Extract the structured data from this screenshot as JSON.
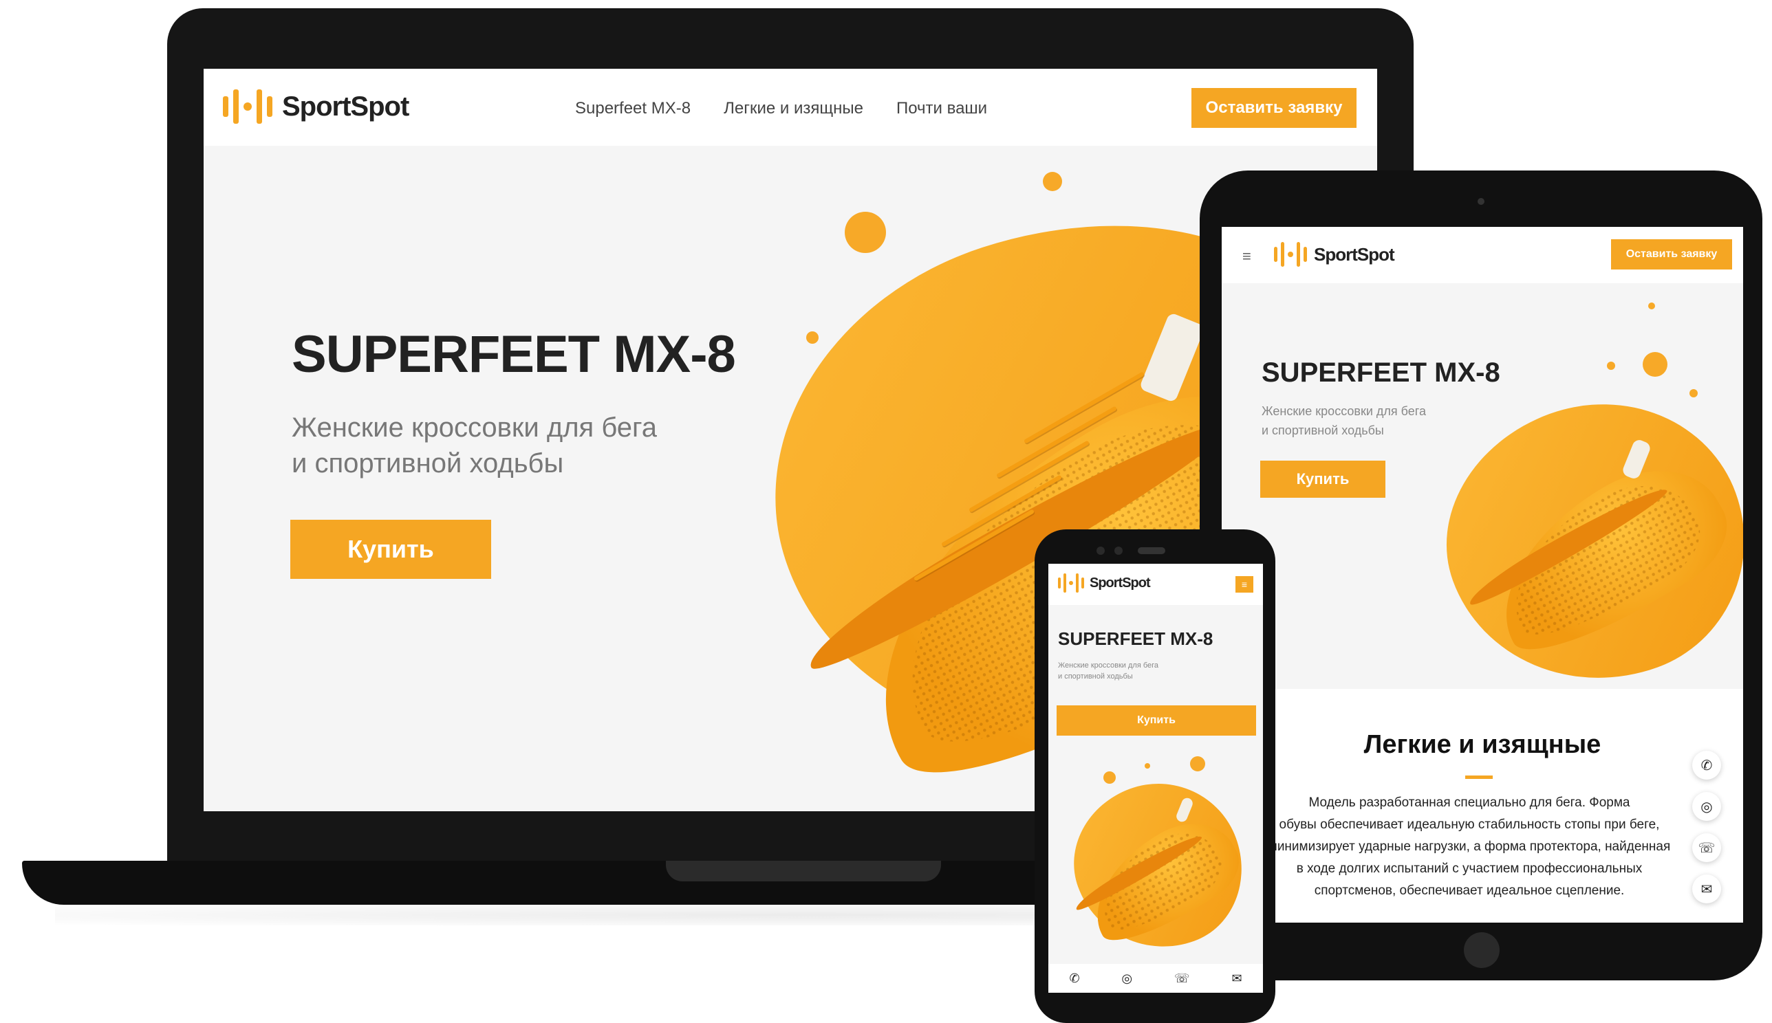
{
  "brand": {
    "name": "SportSpot",
    "accent": "#f5a623"
  },
  "laptop": {
    "nav": [
      "Superfeet MX-8",
      "Легкие и изящные",
      "Почти ваши"
    ],
    "cta": "Оставить заявку",
    "hero": {
      "title": "SUPERFEET MX-8",
      "subtitle_line1": "Женские кроссовки для бега",
      "subtitle_line2": "и спортивной ходьбы",
      "buy": "Купить"
    }
  },
  "tablet": {
    "menu_icon": "≡",
    "cta": "Оставить заявку",
    "hero": {
      "title": "SUPERFEET MX-8",
      "subtitle_line1": "Женские кроссовки для бега",
      "subtitle_line2": "и спортивной ходьбы",
      "buy": "Купить"
    },
    "section": {
      "title": "Легкие и изящные",
      "body_lines": [
        "Модель разработанная специально для бега. Форма",
        "обувы обеспечивает идеальную стабильность стопы при беге,",
        "минимизирует ударные нагрузки, а форма протектора, найденная",
        "в ходе долгих испытаний с участием профессиональных",
        "спортсменов, обеспечивает идеальное сцепление."
      ]
    },
    "social": [
      "phone-icon",
      "instagram-icon",
      "whatsapp-icon",
      "mail-icon"
    ]
  },
  "phone": {
    "hero": {
      "title": "SUPERFEET MX-8",
      "subtitle_line1": "Женские кроссовки для бега",
      "subtitle_line2": "и спортивной ходьбы",
      "buy": "Купить"
    },
    "bottom_icons": [
      "phone-icon",
      "instagram-icon",
      "whatsapp-icon",
      "mail-icon"
    ]
  },
  "glyphs": {
    "phone": "✆",
    "instagram": "◎",
    "whatsapp": "☏",
    "mail": "✉",
    "menu": "≡"
  }
}
